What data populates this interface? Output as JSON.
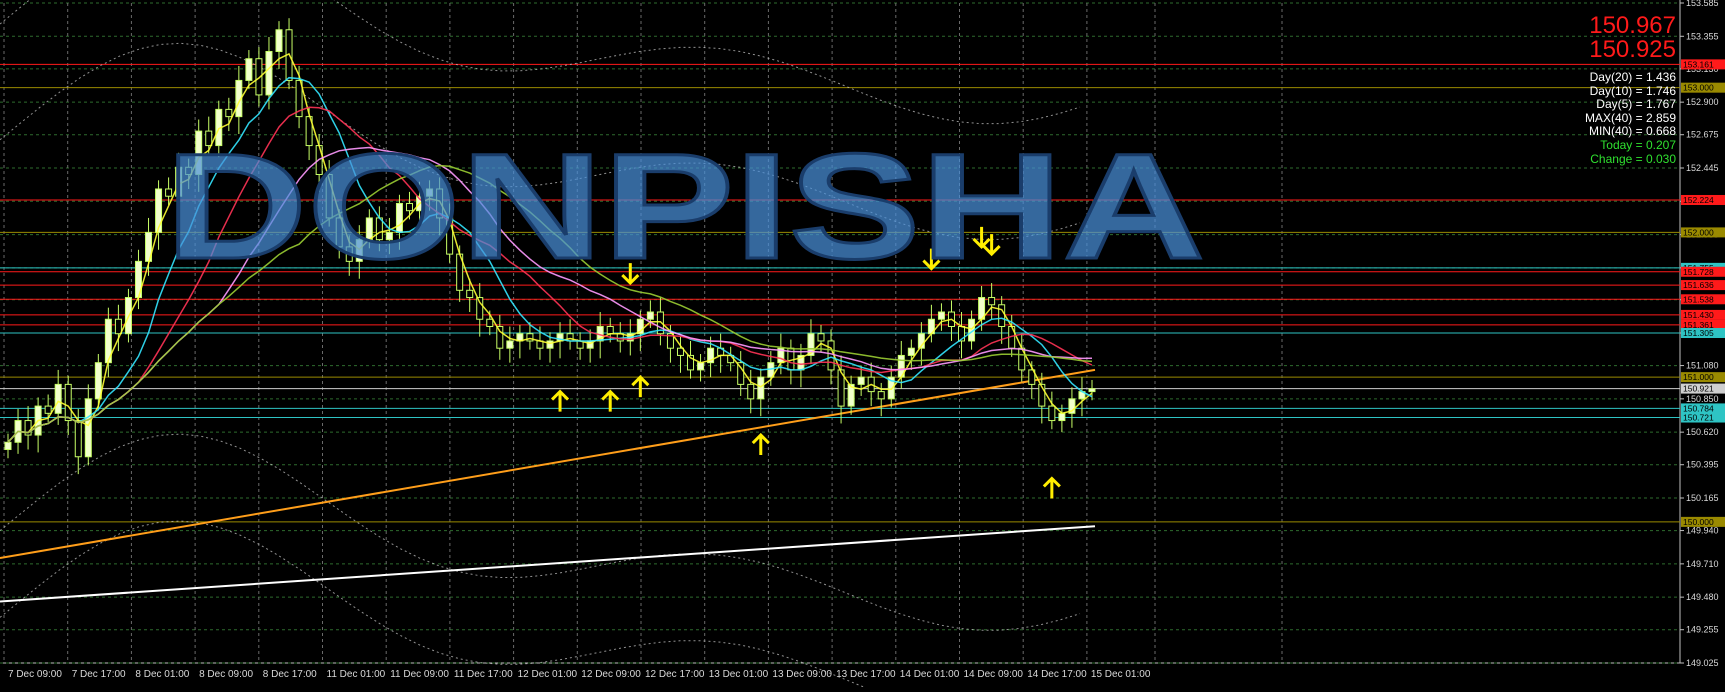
{
  "window": {
    "bg_color": "#000000"
  },
  "chart_data": {
    "type": "candlestick",
    "symbol_prices": {
      "bid": "150.967",
      "ask": "150.925"
    },
    "stats": [
      {
        "label": "Day(20) = 1.436",
        "color": "#ffffff"
      },
      {
        "label": "Day(10) = 1.746",
        "color": "#ffffff"
      },
      {
        "label": "Day(5) = 1.767",
        "color": "#ffffff"
      },
      {
        "label": "MAX(40) = 2.859",
        "color": "#ffffff"
      },
      {
        "label": "MIN(40) = 0.668",
        "color": "#ffffff"
      },
      {
        "label": "Today = 0.207",
        "color": "#2fe02f"
      },
      {
        "label": "Change = 0.030",
        "color": "#2fe02f"
      }
    ],
    "watermark": "DONPISHA",
    "y_axis": {
      "min": 149.025,
      "max": 153.585,
      "ticks": [
        "153.585",
        "153.355",
        "153.130",
        "152.900",
        "152.675",
        "152.445",
        "152.215",
        "151.985",
        "151.755",
        "151.535",
        "151.305",
        "151.080",
        "150.850",
        "150.620",
        "150.395",
        "150.165",
        "149.940",
        "149.710",
        "149.480",
        "149.255",
        "149.025"
      ]
    },
    "x_axis": {
      "labels": [
        "7 Dec 09:00",
        "7 Dec 17:00",
        "8 Dec 01:00",
        "8 Dec 09:00",
        "8 Dec 17:00",
        "11 Dec 01:00",
        "11 Dec 09:00",
        "11 Dec 17:00",
        "12 Dec 01:00",
        "12 Dec 09:00",
        "12 Dec 17:00",
        "13 Dec 01:00",
        "13 Dec 09:00",
        "13 Dec 17:00",
        "14 Dec 01:00",
        "14 Dec 09:00",
        "14 Dec 17:00",
        "15 Dec 01:00"
      ]
    },
    "levels": [
      {
        "value": 153.161,
        "label": "153.161",
        "color": "#ff1a1a"
      },
      {
        "value": 153.0,
        "label": "153.000",
        "color": "#9a8a00"
      },
      {
        "value": 152.224,
        "label": "152.224",
        "color": "#ff1a1a"
      },
      {
        "value": 152.0,
        "label": "152.000",
        "color": "#9a8a00"
      },
      {
        "value": 151.755,
        "label": "151.755",
        "color": "#2ec4c4"
      },
      {
        "value": 151.728,
        "label": "151.728",
        "color": "#ff1a1a"
      },
      {
        "value": 151.636,
        "label": "151.636",
        "color": "#ff1a1a"
      },
      {
        "value": 151.538,
        "label": "151.538",
        "color": "#ff1a1a"
      },
      {
        "value": 151.43,
        "label": "151.430",
        "color": "#ff1a1a"
      },
      {
        "value": 151.361,
        "label": "151.361",
        "color": "#ff1a1a"
      },
      {
        "value": 151.305,
        "label": "151.305",
        "color": "#2ec4c4"
      },
      {
        "value": 151.0,
        "label": "151.000",
        "color": "#9a8a00"
      },
      {
        "value": 150.921,
        "label": "150.921",
        "color": "#cfcfcf"
      },
      {
        "value": 150.784,
        "label": "150.784",
        "color": "#2ec4c4"
      },
      {
        "value": 150.721,
        "label": "150.721",
        "color": "#2ec4c4"
      },
      {
        "value": 150.0,
        "label": "150.000",
        "color": "#9a8a00"
      }
    ],
    "closes": [
      150.55,
      150.7,
      150.6,
      150.8,
      150.75,
      150.95,
      150.7,
      150.45,
      150.85,
      151.1,
      151.4,
      151.3,
      151.55,
      151.8,
      152.0,
      152.3,
      152.25,
      152.45,
      152.4,
      152.7,
      152.6,
      152.85,
      152.8,
      153.05,
      153.2,
      152.95,
      153.25,
      153.4,
      153.05,
      152.8,
      152.6,
      152.4,
      152.1,
      151.9,
      151.8,
      151.95,
      152.1,
      151.95,
      152.0,
      152.2,
      152.15,
      152.25,
      152.3,
      152.1,
      151.85,
      151.6,
      151.55,
      151.4,
      151.35,
      151.2,
      151.25,
      151.3,
      151.25,
      151.2,
      151.25,
      151.3,
      151.25,
      151.2,
      151.25,
      151.35,
      151.3,
      151.25,
      151.3,
      151.4,
      151.45,
      151.3,
      151.2,
      151.15,
      151.05,
      151.1,
      151.2,
      151.15,
      151.1,
      150.95,
      150.85,
      151.0,
      151.1,
      151.2,
      151.05,
      151.15,
      151.3,
      151.25,
      151.05,
      150.8,
      150.95,
      151.0,
      150.9,
      150.85,
      151.0,
      151.15,
      151.2,
      151.3,
      151.4,
      151.45,
      151.35,
      151.25,
      151.4,
      151.55,
      151.5,
      151.35,
      151.2,
      151.05,
      150.95,
      150.8,
      150.7,
      150.75,
      150.85,
      150.9,
      150.92
    ],
    "ma_lines": [
      {
        "name": "MA orange",
        "color": "#ff9e1a",
        "start": 149.75,
        "end": 151.05
      },
      {
        "name": "MA white",
        "color": "#ffffff",
        "start": 149.45,
        "end": 149.97
      }
    ],
    "arrows": [
      {
        "index": 27,
        "dir": "down"
      },
      {
        "index": 55,
        "dir": "up"
      },
      {
        "index": 60,
        "dir": "up"
      },
      {
        "index": 62,
        "dir": "down"
      },
      {
        "index": 63,
        "dir": "up"
      },
      {
        "index": 75,
        "dir": "up"
      },
      {
        "index": 92,
        "dir": "down"
      },
      {
        "index": 97,
        "dir": "down"
      },
      {
        "index": 98,
        "dir": "down"
      },
      {
        "index": 104,
        "dir": "up"
      }
    ]
  }
}
